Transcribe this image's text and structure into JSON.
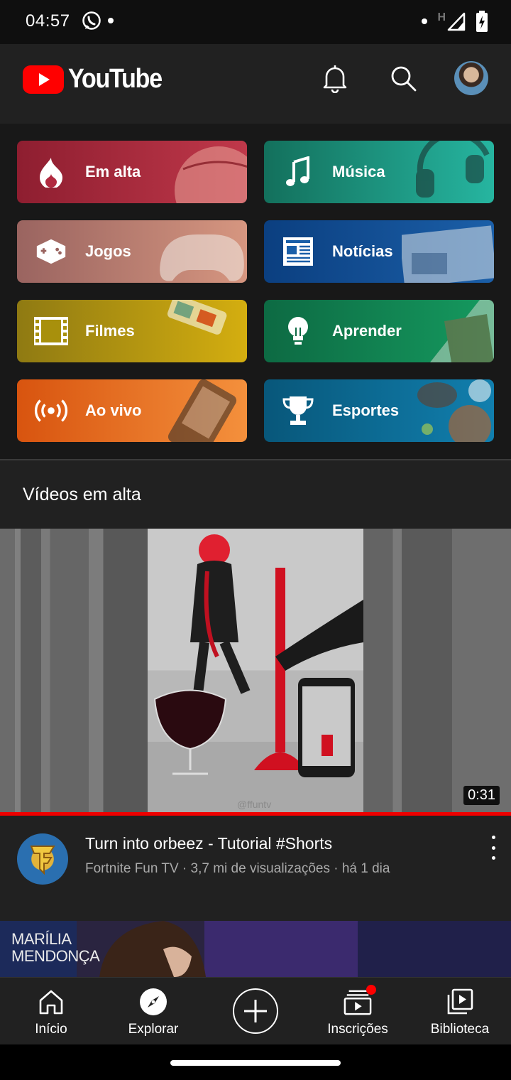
{
  "status_bar": {
    "time": "04:57",
    "network_label": "H"
  },
  "app_bar": {
    "logo_text": "YouTube",
    "brand_color": "#ff0000"
  },
  "categories": [
    {
      "label": "Em alta",
      "icon": "trending-flame-icon",
      "color": "#9b2335"
    },
    {
      "label": "Música",
      "icon": "music-note-icon",
      "color": "#17876f"
    },
    {
      "label": "Jogos",
      "icon": "gamepad-icon",
      "color": "#a56b60"
    },
    {
      "label": "Notícias",
      "icon": "newspaper-icon",
      "color": "#0f4f96"
    },
    {
      "label": "Filmes",
      "icon": "film-strip-icon",
      "color": "#a8900c"
    },
    {
      "label": "Aprender",
      "icon": "lightbulb-icon",
      "color": "#11744a"
    },
    {
      "label": "Ao vivo",
      "icon": "live-broadcast-icon",
      "color": "#e06418"
    },
    {
      "label": "Esportes",
      "icon": "trophy-icon",
      "color": "#0b6a94"
    }
  ],
  "section": {
    "title": "Vídeos em alta"
  },
  "video": {
    "duration": "0:31",
    "watched_fraction": 1.0,
    "title": "Turn into orbeez - Tutorial #Shorts",
    "subtitle": "Fortnite Fun TV · 3,7 mi de visualizações · há 1 dia",
    "watermark": "@ffuntv"
  },
  "next_video": {
    "thumbnail_text_line1": "MARÍLIA",
    "thumbnail_text_line2": "MENDONÇA"
  },
  "bottom_nav": {
    "home": "Início",
    "explore": "Explorar",
    "subscriptions": "Inscrições",
    "library": "Biblioteca"
  }
}
